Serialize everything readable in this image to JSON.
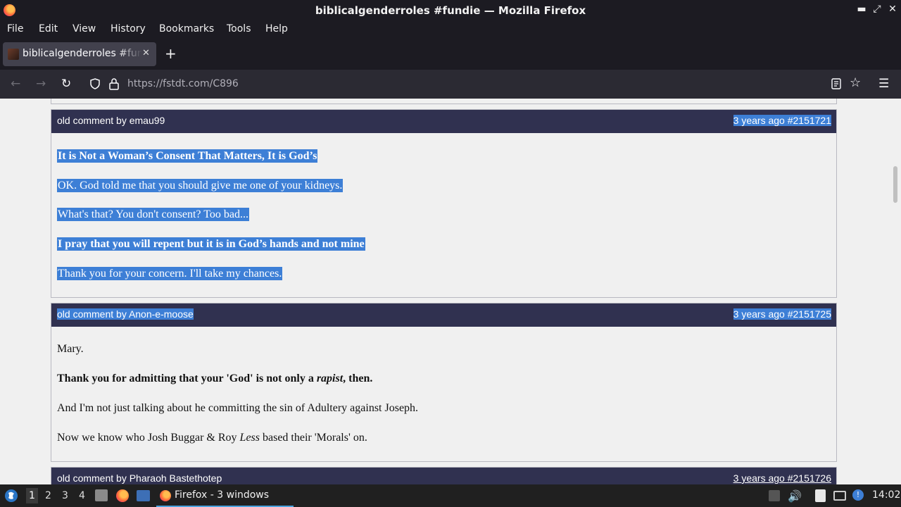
{
  "window": {
    "title": "biblicalgenderroles #fundie — Mozilla Firefox",
    "controls": {
      "minimize": "▬",
      "maximize": "⤢",
      "close": "✕"
    }
  },
  "menu": [
    "File",
    "Edit",
    "View",
    "History",
    "Bookmarks",
    "Tools",
    "Help"
  ],
  "tab": {
    "label": "biblicalgenderroles #fundie",
    "close": "✕",
    "new": "+"
  },
  "nav": {
    "url_host": "https://fstdt.com",
    "url_path": "/C896"
  },
  "comments": [
    {
      "author": "old comment by emau99",
      "meta": "3 years ago #2151721",
      "lines": [
        {
          "text": "It is Not a Woman’s Consent That Matters, It is God’s",
          "bold": true
        },
        {
          "text": "OK. God told me that you should give me one of your kidneys.",
          "bold": false
        },
        {
          "text": "What's that? You don't consent? Too bad...",
          "bold": false
        },
        {
          "text": "I pray that you will repent  but it is in God’s hands and not mine",
          "bold": true
        },
        {
          "text": "Thank you for your concern. I'll take my chances.",
          "bold": false
        }
      ]
    },
    {
      "author": "old comment by Anon-e-moose",
      "meta": "3 years ago #2151725",
      "lines": [
        {
          "text": "Mary."
        },
        {
          "pre": "Thank you for admitting that your 'God' is not only a ",
          "em": "rapist",
          "post": ", then."
        },
        {
          "text": "And I'm not just talking about he committing the sin of Adultery against Joseph."
        },
        {
          "pre2": "Now we know who Josh Buggar & Roy ",
          "em2": "Less",
          "post2": " based their 'Morals' on."
        }
      ]
    },
    {
      "author": "old comment by Pharaoh Bastethotep",
      "meta": "3 years ago #2151726"
    }
  ],
  "taskbar": {
    "workspaces": [
      "1",
      "2",
      "3",
      "4"
    ],
    "window_label": "Firefox - 3 windows",
    "clock": "14:02"
  },
  "colors": {
    "comment_header": "#303150",
    "selection": "#3d7fd6",
    "page_bg": "#f0f0f0"
  }
}
